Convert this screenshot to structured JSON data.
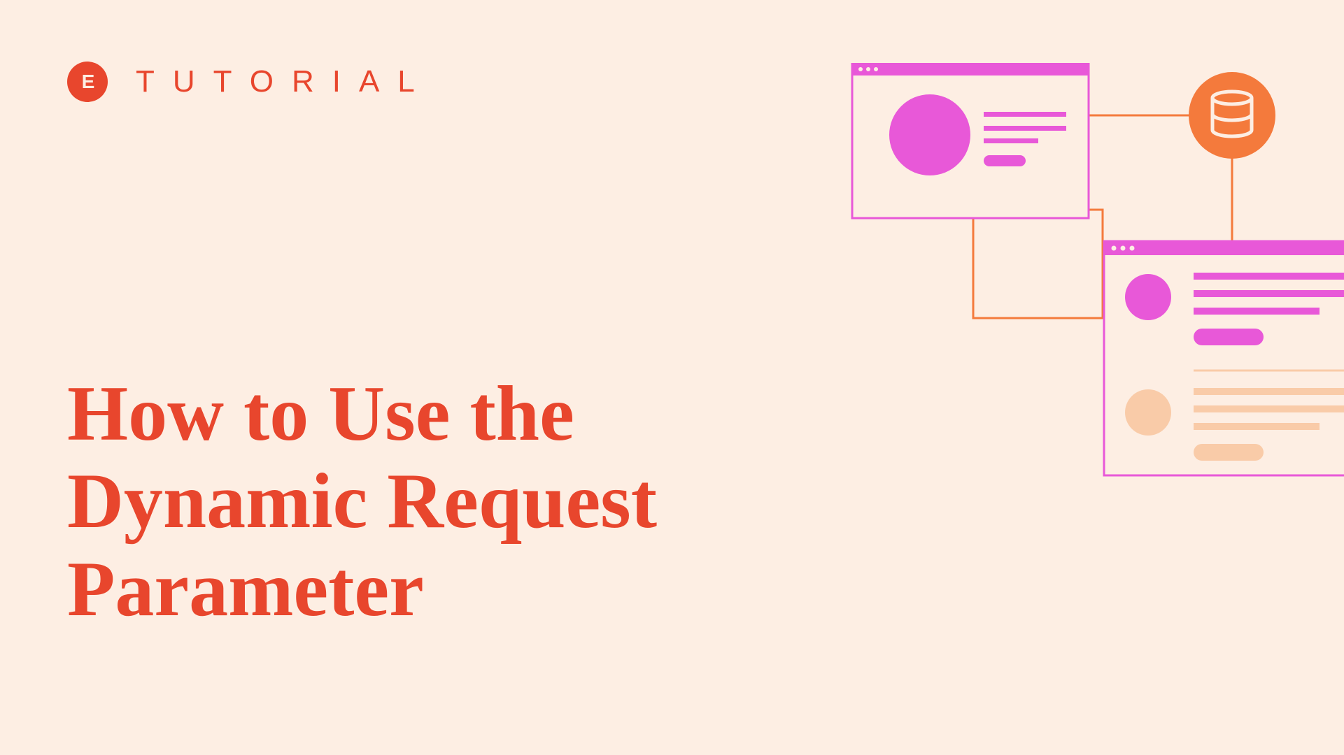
{
  "header": {
    "label": "TUTORIAL"
  },
  "main": {
    "headline": "How to Use the Dynamic Request Parameter"
  },
  "colors": {
    "accent": "#e8462d",
    "magenta": "#e858d8",
    "orange": "#f47a3c",
    "peach": "#f9cba8",
    "bg": "#fdeee3"
  }
}
